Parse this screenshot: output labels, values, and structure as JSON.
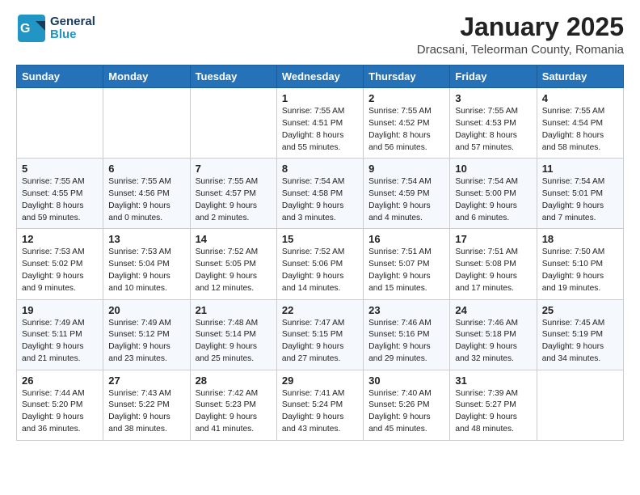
{
  "logo": {
    "line1": "General",
    "line2": "Blue"
  },
  "header": {
    "month": "January 2025",
    "location": "Dracsani, Teleorman County, Romania"
  },
  "weekdays": [
    "Sunday",
    "Monday",
    "Tuesday",
    "Wednesday",
    "Thursday",
    "Friday",
    "Saturday"
  ],
  "weeks": [
    [
      {
        "day": "",
        "info": ""
      },
      {
        "day": "",
        "info": ""
      },
      {
        "day": "",
        "info": ""
      },
      {
        "day": "1",
        "info": "Sunrise: 7:55 AM\nSunset: 4:51 PM\nDaylight: 8 hours\nand 55 minutes."
      },
      {
        "day": "2",
        "info": "Sunrise: 7:55 AM\nSunset: 4:52 PM\nDaylight: 8 hours\nand 56 minutes."
      },
      {
        "day": "3",
        "info": "Sunrise: 7:55 AM\nSunset: 4:53 PM\nDaylight: 8 hours\nand 57 minutes."
      },
      {
        "day": "4",
        "info": "Sunrise: 7:55 AM\nSunset: 4:54 PM\nDaylight: 8 hours\nand 58 minutes."
      }
    ],
    [
      {
        "day": "5",
        "info": "Sunrise: 7:55 AM\nSunset: 4:55 PM\nDaylight: 8 hours\nand 59 minutes."
      },
      {
        "day": "6",
        "info": "Sunrise: 7:55 AM\nSunset: 4:56 PM\nDaylight: 9 hours\nand 0 minutes."
      },
      {
        "day": "7",
        "info": "Sunrise: 7:55 AM\nSunset: 4:57 PM\nDaylight: 9 hours\nand 2 minutes."
      },
      {
        "day": "8",
        "info": "Sunrise: 7:54 AM\nSunset: 4:58 PM\nDaylight: 9 hours\nand 3 minutes."
      },
      {
        "day": "9",
        "info": "Sunrise: 7:54 AM\nSunset: 4:59 PM\nDaylight: 9 hours\nand 4 minutes."
      },
      {
        "day": "10",
        "info": "Sunrise: 7:54 AM\nSunset: 5:00 PM\nDaylight: 9 hours\nand 6 minutes."
      },
      {
        "day": "11",
        "info": "Sunrise: 7:54 AM\nSunset: 5:01 PM\nDaylight: 9 hours\nand 7 minutes."
      }
    ],
    [
      {
        "day": "12",
        "info": "Sunrise: 7:53 AM\nSunset: 5:02 PM\nDaylight: 9 hours\nand 9 minutes."
      },
      {
        "day": "13",
        "info": "Sunrise: 7:53 AM\nSunset: 5:04 PM\nDaylight: 9 hours\nand 10 minutes."
      },
      {
        "day": "14",
        "info": "Sunrise: 7:52 AM\nSunset: 5:05 PM\nDaylight: 9 hours\nand 12 minutes."
      },
      {
        "day": "15",
        "info": "Sunrise: 7:52 AM\nSunset: 5:06 PM\nDaylight: 9 hours\nand 14 minutes."
      },
      {
        "day": "16",
        "info": "Sunrise: 7:51 AM\nSunset: 5:07 PM\nDaylight: 9 hours\nand 15 minutes."
      },
      {
        "day": "17",
        "info": "Sunrise: 7:51 AM\nSunset: 5:08 PM\nDaylight: 9 hours\nand 17 minutes."
      },
      {
        "day": "18",
        "info": "Sunrise: 7:50 AM\nSunset: 5:10 PM\nDaylight: 9 hours\nand 19 minutes."
      }
    ],
    [
      {
        "day": "19",
        "info": "Sunrise: 7:49 AM\nSunset: 5:11 PM\nDaylight: 9 hours\nand 21 minutes."
      },
      {
        "day": "20",
        "info": "Sunrise: 7:49 AM\nSunset: 5:12 PM\nDaylight: 9 hours\nand 23 minutes."
      },
      {
        "day": "21",
        "info": "Sunrise: 7:48 AM\nSunset: 5:14 PM\nDaylight: 9 hours\nand 25 minutes."
      },
      {
        "day": "22",
        "info": "Sunrise: 7:47 AM\nSunset: 5:15 PM\nDaylight: 9 hours\nand 27 minutes."
      },
      {
        "day": "23",
        "info": "Sunrise: 7:46 AM\nSunset: 5:16 PM\nDaylight: 9 hours\nand 29 minutes."
      },
      {
        "day": "24",
        "info": "Sunrise: 7:46 AM\nSunset: 5:18 PM\nDaylight: 9 hours\nand 32 minutes."
      },
      {
        "day": "25",
        "info": "Sunrise: 7:45 AM\nSunset: 5:19 PM\nDaylight: 9 hours\nand 34 minutes."
      }
    ],
    [
      {
        "day": "26",
        "info": "Sunrise: 7:44 AM\nSunset: 5:20 PM\nDaylight: 9 hours\nand 36 minutes."
      },
      {
        "day": "27",
        "info": "Sunrise: 7:43 AM\nSunset: 5:22 PM\nDaylight: 9 hours\nand 38 minutes."
      },
      {
        "day": "28",
        "info": "Sunrise: 7:42 AM\nSunset: 5:23 PM\nDaylight: 9 hours\nand 41 minutes."
      },
      {
        "day": "29",
        "info": "Sunrise: 7:41 AM\nSunset: 5:24 PM\nDaylight: 9 hours\nand 43 minutes."
      },
      {
        "day": "30",
        "info": "Sunrise: 7:40 AM\nSunset: 5:26 PM\nDaylight: 9 hours\nand 45 minutes."
      },
      {
        "day": "31",
        "info": "Sunrise: 7:39 AM\nSunset: 5:27 PM\nDaylight: 9 hours\nand 48 minutes."
      },
      {
        "day": "",
        "info": ""
      }
    ]
  ]
}
